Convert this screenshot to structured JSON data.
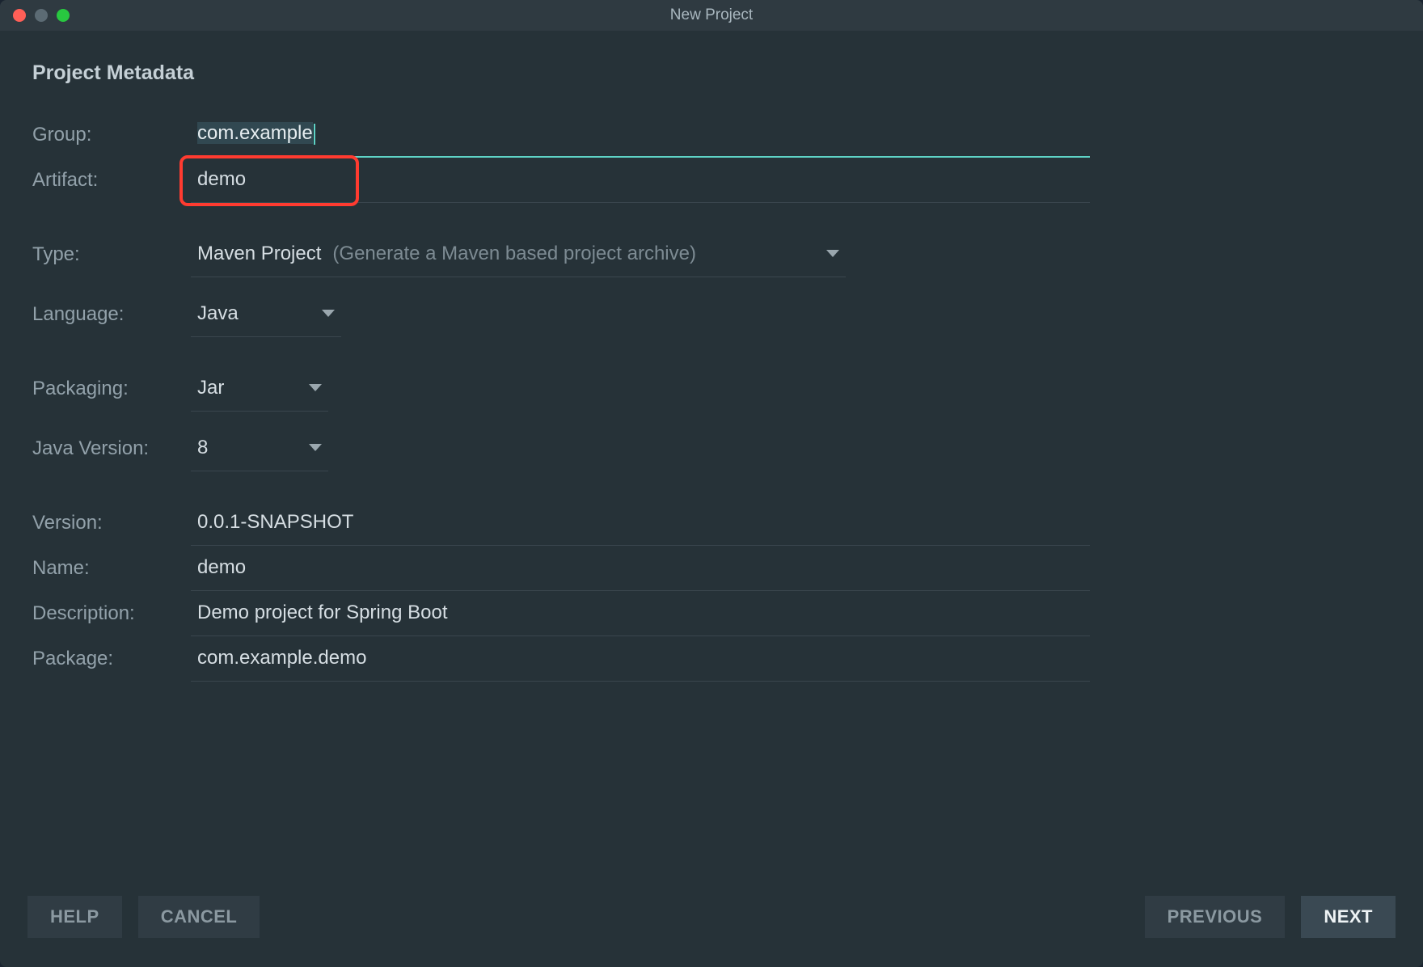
{
  "window": {
    "title": "New Project"
  },
  "section": {
    "title": "Project Metadata"
  },
  "labels": {
    "group": "Group:",
    "artifact": "Artifact:",
    "type": "Type:",
    "language": "Language:",
    "packaging": "Packaging:",
    "javaVersion": "Java Version:",
    "version": "Version:",
    "name": "Name:",
    "description": "Description:",
    "package": "Package:"
  },
  "values": {
    "group": "com.example",
    "artifact": "demo",
    "type": "Maven Project",
    "typeHint": "(Generate a Maven based project archive)",
    "language": "Java",
    "packaging": "Jar",
    "javaVersion": "8",
    "version": "0.0.1-SNAPSHOT",
    "name": "demo",
    "description": "Demo project for Spring Boot",
    "package": "com.example.demo"
  },
  "buttons": {
    "help": "HELP",
    "cancel": "CANCEL",
    "previous": "PREVIOUS",
    "next": "NEXT"
  },
  "colors": {
    "accent": "#5ed3c6",
    "highlight": "#ff3b30",
    "bg": "#263238"
  }
}
